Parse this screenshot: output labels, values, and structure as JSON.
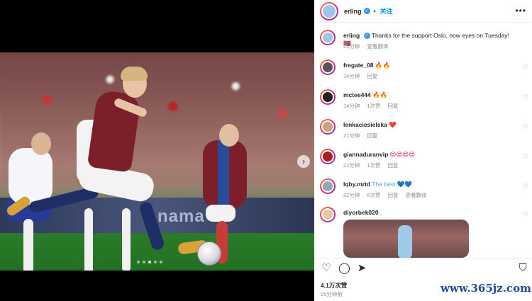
{
  "post": {
    "username": "erling",
    "verified_badge": "verified-icon",
    "separator": "•",
    "follow_label": "关注",
    "more_label": "•••"
  },
  "caption": {
    "username": "erling",
    "text": "Thanks for the support Oslo, now eyes on Tuesday! 🇳🇴",
    "age": "25分钟",
    "translate_label": "查看翻译"
  },
  "media": {
    "board_text": "nama",
    "carousel_dots": 5,
    "carousel_active": 2
  },
  "comments": [
    {
      "username": "fregate_08",
      "text": "🔥🔥",
      "age": "14分钟",
      "likes": "",
      "reply": "回复",
      "translate": ""
    },
    {
      "username": "mctee444",
      "text": "🔥🔥",
      "age": "14分钟",
      "likes": "1次赞",
      "reply": "回复",
      "translate": ""
    },
    {
      "username": "lenkaciesielska",
      "text": "❤️",
      "age": "21分钟",
      "likes": "",
      "reply": "回复",
      "translate": ""
    },
    {
      "username": "giannaduranvip",
      "text": "😍😍😍😍",
      "age": "22分钟",
      "likes": "1次赞",
      "reply": "回复",
      "translate": ""
    },
    {
      "username": "lqby.mrtd",
      "text": "The best 💙💙",
      "age": "22分钟",
      "likes": "6次赞",
      "reply": "回复",
      "translate": "查看翻译"
    },
    {
      "username": "diyorbek020_",
      "text": "",
      "age": "",
      "likes": "",
      "reply": "",
      "translate": ""
    }
  ],
  "footer": {
    "likes": "4.1万次赞",
    "time": "25分钟前"
  },
  "watermark": "www.365jz.com",
  "colors": {
    "accent": "#0095f6",
    "text": "#262626",
    "muted": "#8e8e8e"
  }
}
